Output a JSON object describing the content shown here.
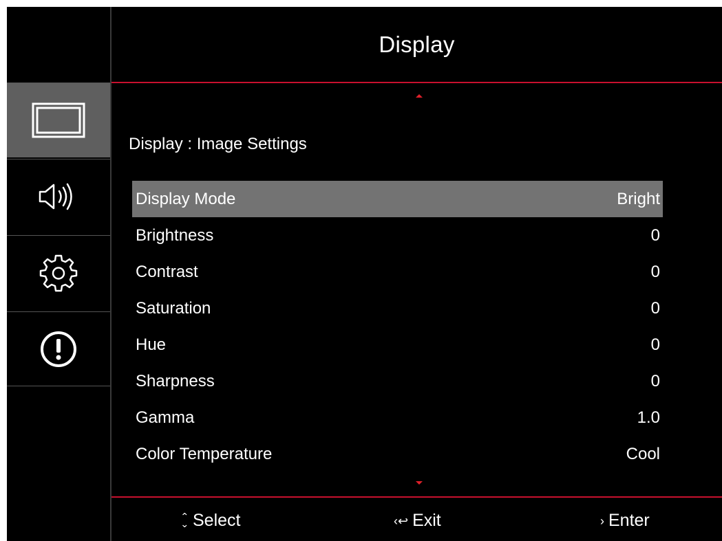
{
  "header": {
    "title": "Display"
  },
  "sidebar": {
    "items": [
      {
        "name": "display",
        "icon": "display-icon",
        "active": true
      },
      {
        "name": "audio",
        "icon": "speaker-icon",
        "active": false
      },
      {
        "name": "setup",
        "icon": "gear-icon",
        "active": false
      },
      {
        "name": "info",
        "icon": "info-exclamation-icon",
        "active": false
      }
    ]
  },
  "section_title": "Display : Image Settings",
  "menu": {
    "items": [
      {
        "label": "Display Mode",
        "value": "Bright",
        "selected": true
      },
      {
        "label": "Brightness",
        "value": "0"
      },
      {
        "label": "Contrast",
        "value": "0"
      },
      {
        "label": "Saturation",
        "value": "0"
      },
      {
        "label": "Hue",
        "value": "0"
      },
      {
        "label": "Sharpness",
        "value": "0"
      },
      {
        "label": "Gamma",
        "value": "1.0"
      },
      {
        "label": "Color Temperature",
        "value": "Cool"
      }
    ]
  },
  "footer": {
    "select": {
      "icon": "⌃⌄",
      "label": "Select"
    },
    "exit": {
      "icon": "‹↩",
      "label": "Exit"
    },
    "enter": {
      "icon": "›",
      "label": "Enter"
    }
  },
  "colors": {
    "background": "#000000",
    "accent_red": "#c8102e",
    "active_sidebar": "#5f5f5f",
    "selected_row": "#737373"
  }
}
